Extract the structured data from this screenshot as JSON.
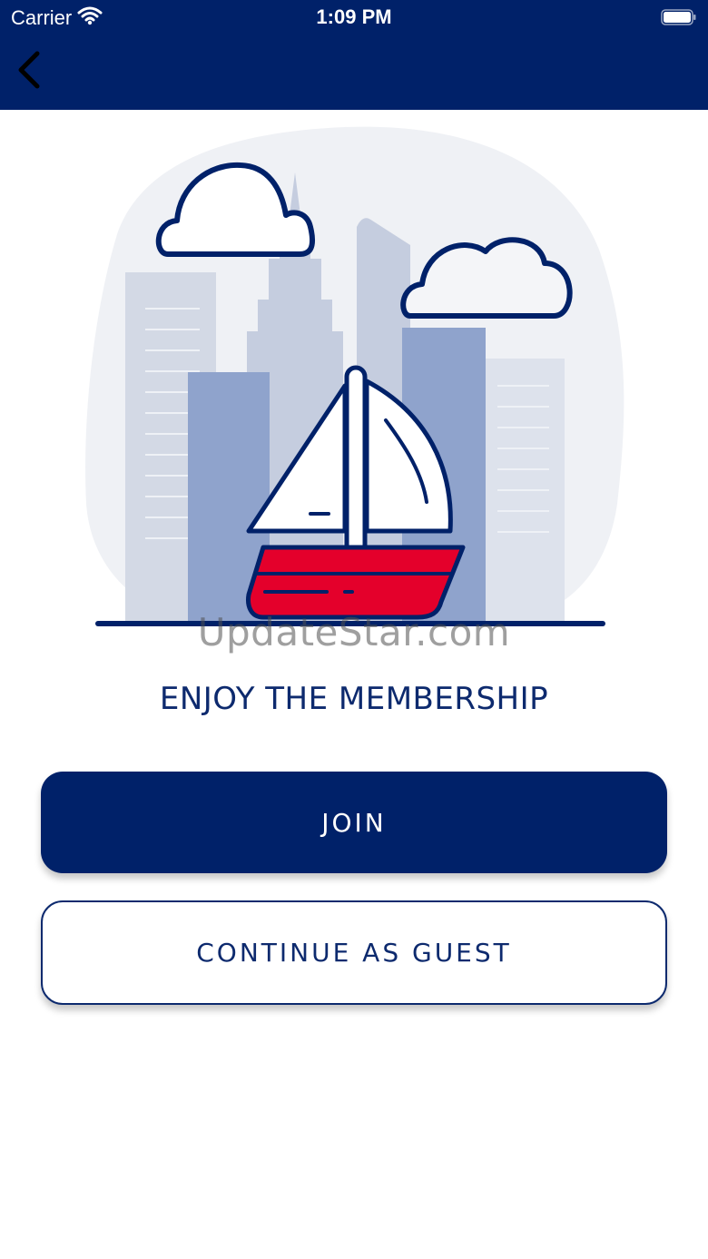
{
  "status_bar": {
    "carrier": "Carrier",
    "time": "1:09 PM",
    "icons": [
      "wifi-icon",
      "battery-icon"
    ]
  },
  "nav": {
    "back_icon": "chevron-left-icon"
  },
  "hero": {
    "illustration": "sailboat-city-illustration"
  },
  "watermark": "UpdateStar.com",
  "title": "ENJOY THE MEMBERSHIP",
  "buttons": {
    "join": "JOIN",
    "guest": "CONTINUE AS GUEST"
  },
  "colors": {
    "primary": "#002169",
    "accent_red": "#E4002B",
    "building_light": "#C5CDDF",
    "building_mid": "#8FA3CC"
  }
}
